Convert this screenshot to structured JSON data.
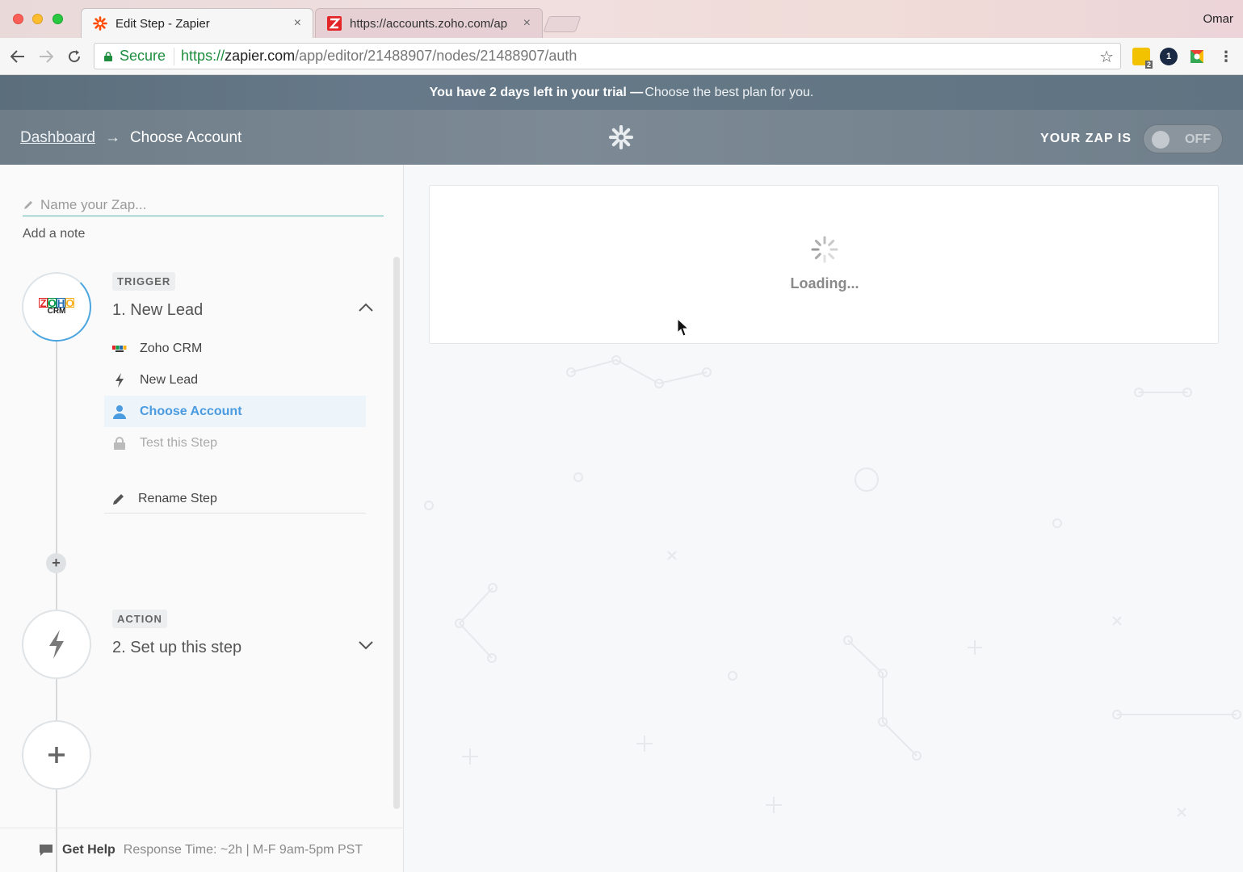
{
  "browser": {
    "tabs": [
      {
        "title": "Edit Step - Zapier",
        "close": "×"
      },
      {
        "title": "https://accounts.zoho.com/ap",
        "close": "×"
      }
    ],
    "profile": "Omar",
    "secure_label": "Secure",
    "url": {
      "scheme": "https://",
      "host": "zapier.com",
      "path": "/app/editor/21488907/nodes/21488907/auth"
    },
    "extensions": [
      "gmail-ext-icon",
      "onepassword-icon",
      "drive-ext-icon"
    ],
    "ext_badge": "2",
    "ext_onepass": "1"
  },
  "trial": {
    "strong": "You have 2 days left in your trial —",
    "link": "Choose the best plan for you."
  },
  "header": {
    "breadcrumb_root": "Dashboard",
    "breadcrumb_arrow": "→",
    "breadcrumb_current": "Choose Account",
    "zap_state_label": "YOUR ZAP IS",
    "toggle_label": "OFF"
  },
  "sidebar": {
    "name_placeholder": "Name your Zap...",
    "add_note": "Add a note",
    "trigger": {
      "badge": "TRIGGER",
      "title": "1. New Lead",
      "app_logo_letters": [
        "Z",
        "O",
        "H",
        "O"
      ],
      "app_logo_sub": "CRM",
      "substeps": [
        {
          "label": "Zoho CRM",
          "icon": "zoho-icon"
        },
        {
          "label": "New Lead",
          "icon": "bolt-icon"
        },
        {
          "label": "Choose Account",
          "icon": "user-icon"
        },
        {
          "label": "Test this Step",
          "icon": "lock-icon"
        }
      ],
      "rename": "Rename Step"
    },
    "add_step_symbol": "+",
    "action": {
      "badge": "ACTION",
      "title": "2. Set up this step"
    },
    "help": {
      "label": "Get Help",
      "info": "Response Time: ~2h | M-F 9am-5pm PST"
    }
  },
  "main": {
    "loading": "Loading..."
  },
  "colors": {
    "accent": "#4a9be0",
    "banner": "#66798a",
    "header": "#7d8a95",
    "brand_orange": "#ff4a00"
  }
}
